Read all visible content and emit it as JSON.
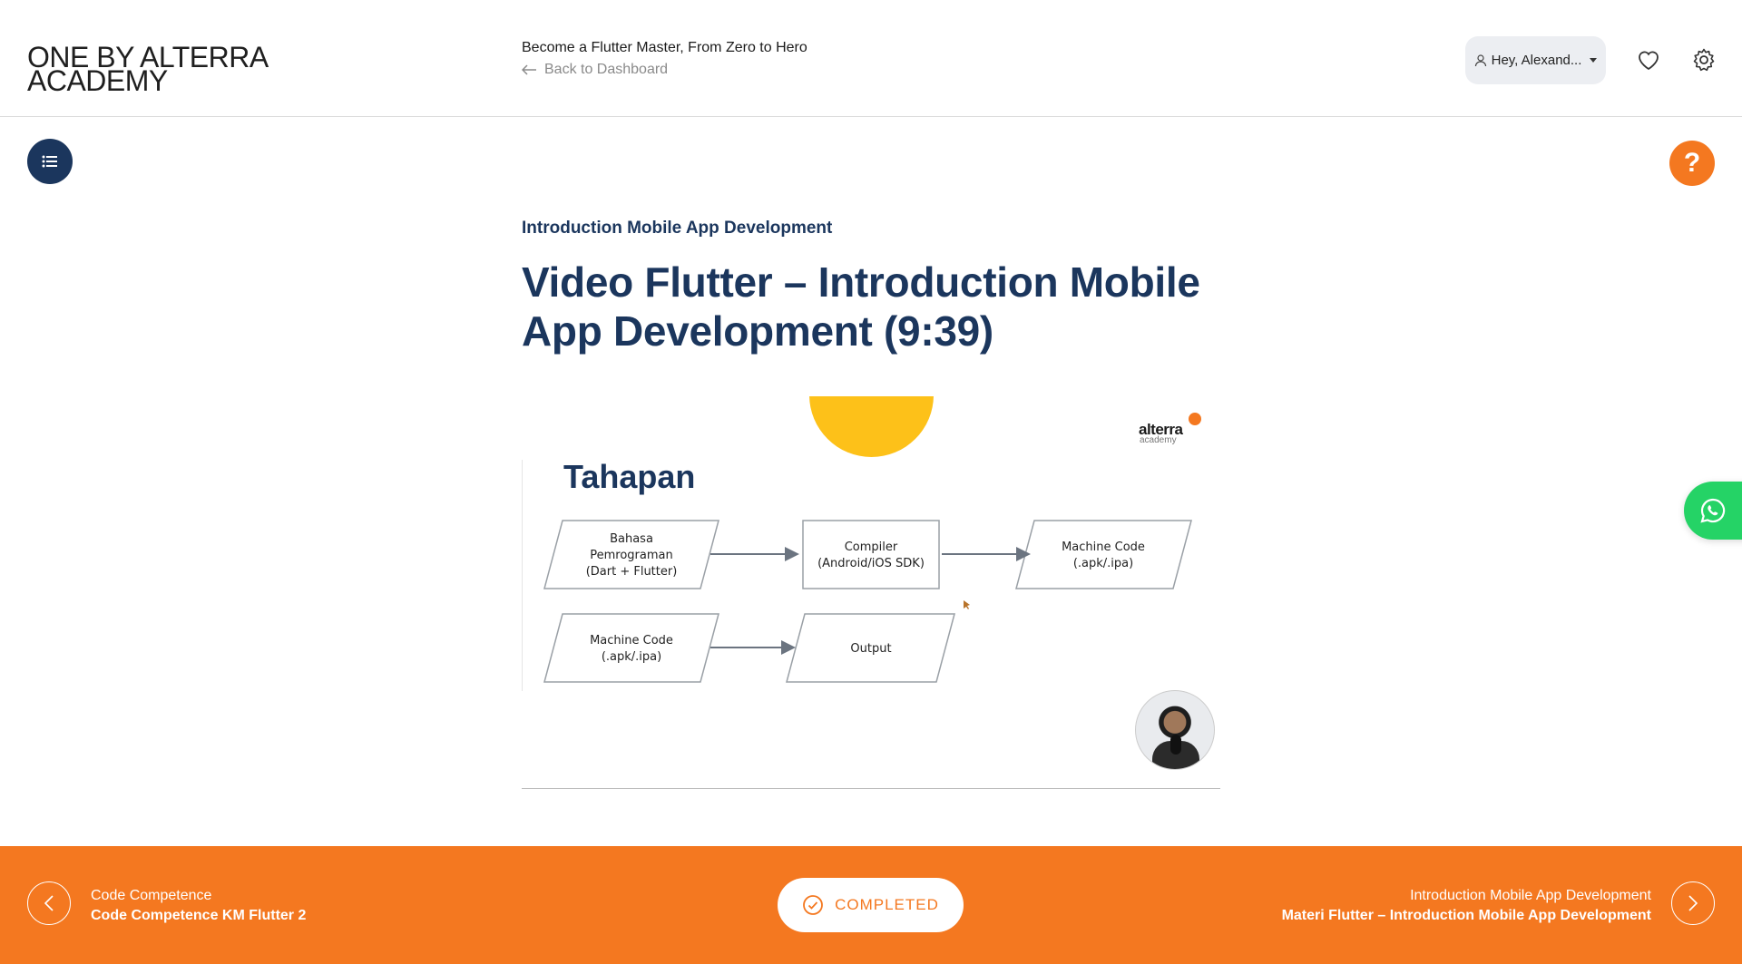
{
  "header": {
    "logo_line1": "ONE BY ALTERRA",
    "logo_line2": "ACADEMY",
    "course_title": "Become a Flutter Master, From Zero to Hero",
    "back_label": "Back to Dashboard",
    "user_label": "Hey, Alexand..."
  },
  "help": {
    "label": "?"
  },
  "lesson": {
    "section": "Introduction Mobile App Development",
    "title": "Video Flutter – Introduction Mobile App Development (9:39)"
  },
  "video": {
    "brand": "alterra",
    "brand_sub": "academy",
    "heading": "Tahapan",
    "flow_row1": [
      [
        "Bahasa",
        "Pemrograman",
        "(Dart + Flutter)"
      ],
      [
        "Compiler",
        "(Android/iOS SDK)"
      ],
      [
        "Machine Code",
        "(.apk/.ipa)"
      ]
    ],
    "flow_row2": [
      [
        "Machine Code",
        "(.apk/.ipa)"
      ],
      [
        "Output"
      ]
    ]
  },
  "footer": {
    "prev_section": "Code Competence",
    "prev_title": "Code Competence KM Flutter 2",
    "completed_label": "COMPLETED",
    "next_section": "Introduction Mobile App Development",
    "next_title": "Materi Flutter – Introduction Mobile App Development"
  },
  "colors": {
    "navy": "#1b365d",
    "orange": "#f47820",
    "whatsapp": "#25d366",
    "sun": "#fdc119"
  },
  "icons": [
    "back-arrow-icon",
    "user-icon",
    "heart-icon",
    "gear-icon",
    "list-icon",
    "question-icon",
    "whatsapp-icon",
    "chevron-left-icon",
    "check-circle-icon",
    "chevron-right-icon"
  ]
}
